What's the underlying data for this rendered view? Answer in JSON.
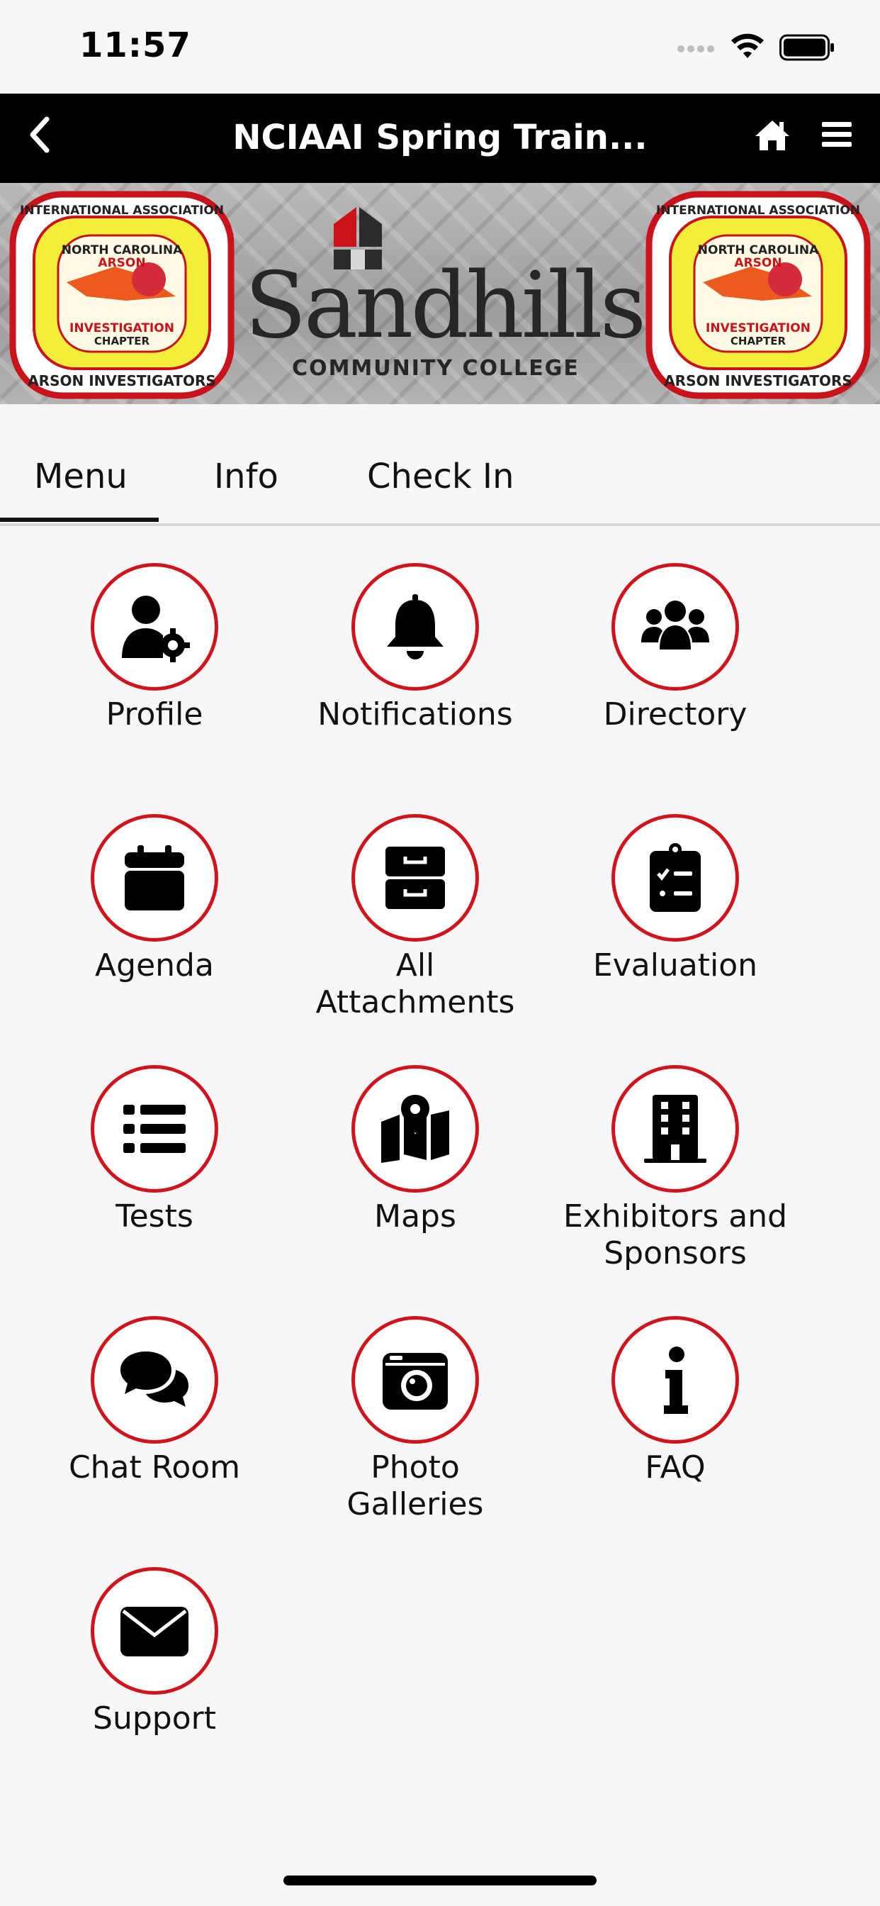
{
  "status_bar": {
    "time": "11:57"
  },
  "nav": {
    "title": "NCIAAI Spring Train..."
  },
  "banner": {
    "badge_text": [
      "INTERNATIONAL ASSOCIATION",
      "NORTH CAROLINA",
      "ARSON",
      "INVESTIGATION",
      "CHAPTER",
      "ARSON INVESTIGATORS"
    ],
    "college_name": "Sandhills",
    "college_subtitle": "COMMUNITY COLLEGE"
  },
  "tabs": [
    {
      "label": "Menu",
      "active": true
    },
    {
      "label": "Info",
      "active": false
    },
    {
      "label": "Check In",
      "active": false
    }
  ],
  "menu_items": [
    {
      "label": "Profile",
      "icon": "user-gear-icon"
    },
    {
      "label": "Notifications",
      "icon": "bell-icon"
    },
    {
      "label": "Directory",
      "icon": "users-icon"
    },
    {
      "label": "Agenda",
      "icon": "calendar-icon"
    },
    {
      "label": "All Attachments",
      "icon": "file-cabinet-icon"
    },
    {
      "label": "Evaluation",
      "icon": "clipboard-check-icon"
    },
    {
      "label": "Tests",
      "icon": "list-icon"
    },
    {
      "label": "Maps",
      "icon": "map-pin-icon"
    },
    {
      "label": "Exhibitors and Sponsors",
      "icon": "building-icon"
    },
    {
      "label": "Chat Room",
      "icon": "chat-bubbles-icon"
    },
    {
      "label": "Photo Galleries",
      "icon": "camera-icon"
    },
    {
      "label": "FAQ",
      "icon": "info-icon"
    },
    {
      "label": "Support",
      "icon": "envelope-icon"
    }
  ],
  "colors": {
    "accent": "#d0141d",
    "navbar": "#000000",
    "background": "#f7f7f7"
  }
}
